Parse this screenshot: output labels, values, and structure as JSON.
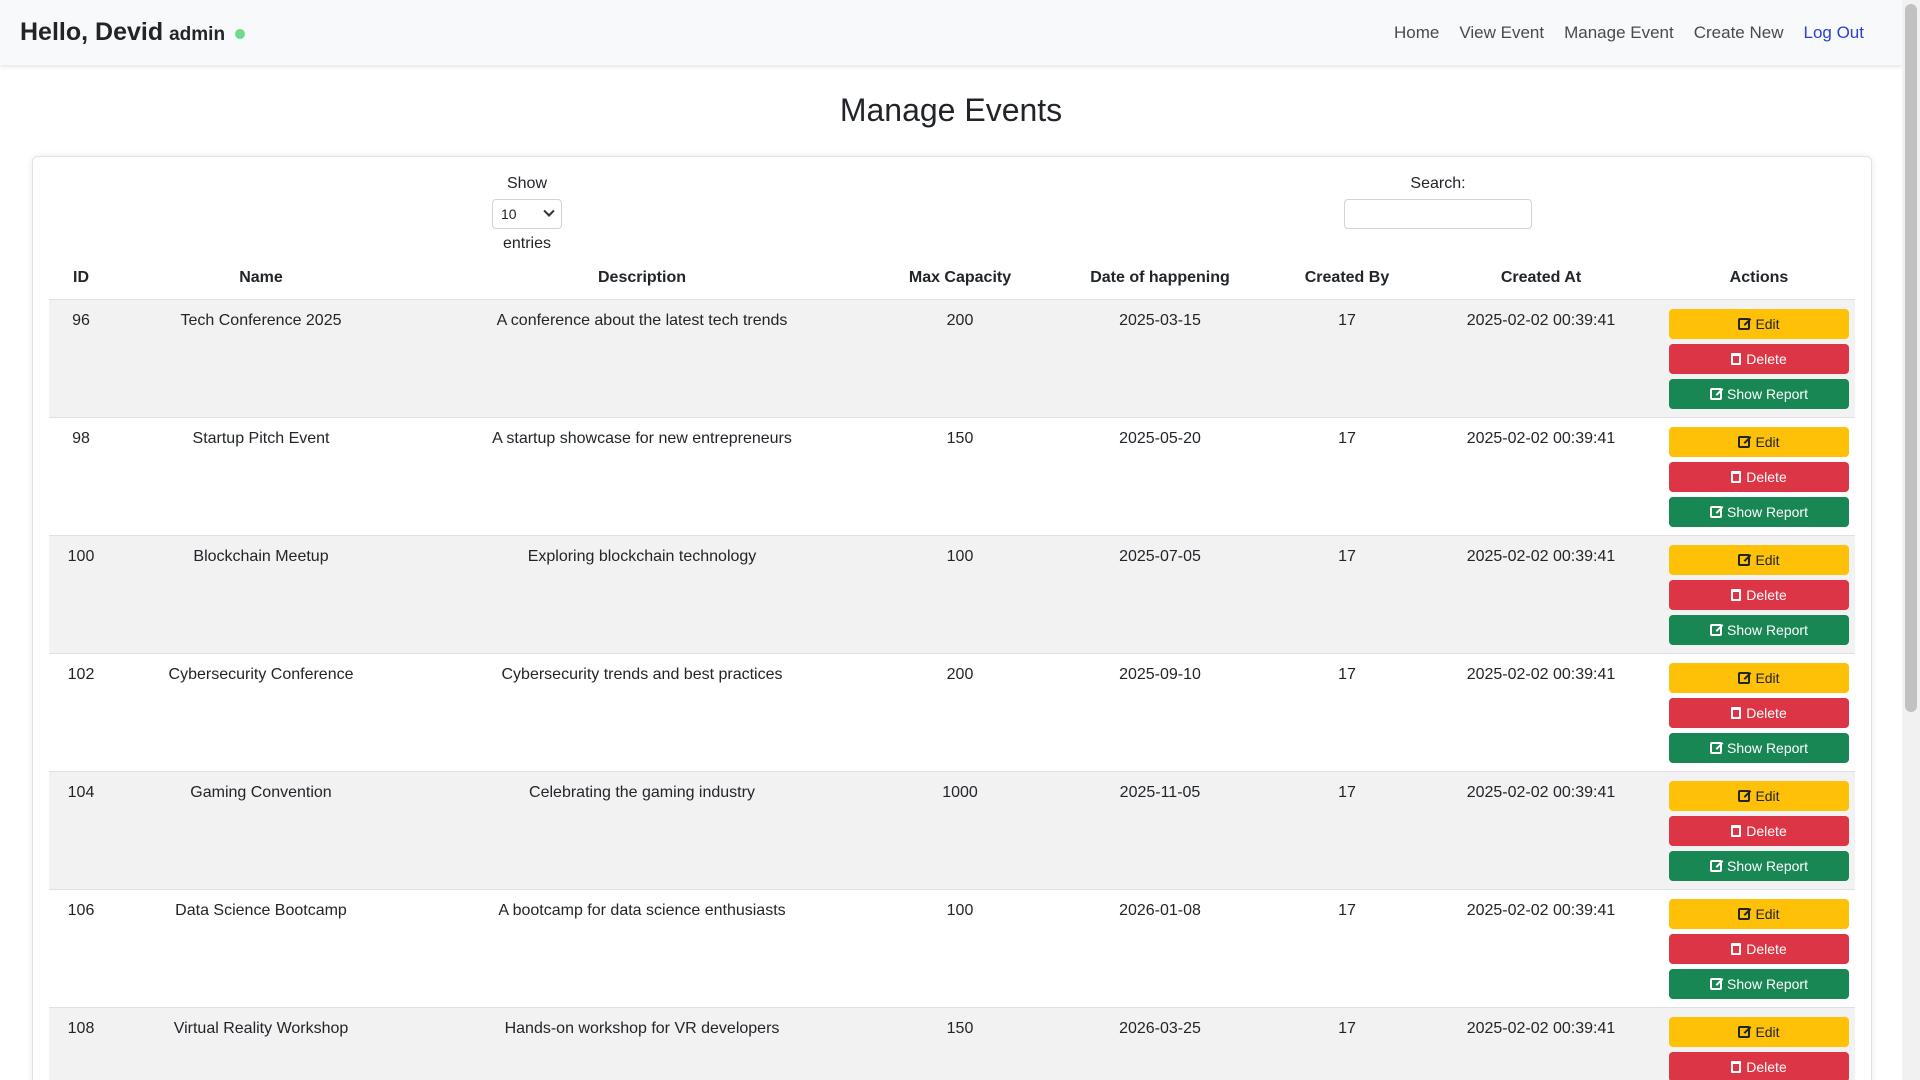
{
  "nav": {
    "greeting": "Hello, Devid",
    "role": "admin",
    "links": [
      "Home",
      "View Event",
      "Manage Event",
      "Create New",
      "Log Out"
    ]
  },
  "page": {
    "title": "Manage Events"
  },
  "length_control": {
    "show_label": "Show",
    "value": "10",
    "entries_label": "entries"
  },
  "search": {
    "label": "Search:",
    "value": ""
  },
  "table": {
    "headers": [
      "ID",
      "Name",
      "Description",
      "Max Capacity",
      "Date of happening",
      "Created By",
      "Created At",
      "Actions"
    ],
    "rows": [
      [
        "96",
        "Tech Conference 2025",
        "A conference about the latest tech trends",
        "200",
        "2025-03-15",
        "17",
        "2025-02-02 00:39:41"
      ],
      [
        "98",
        "Startup Pitch Event",
        "A startup showcase for new entrepreneurs",
        "150",
        "2025-05-20",
        "17",
        "2025-02-02 00:39:41"
      ],
      [
        "100",
        "Blockchain Meetup",
        "Exploring blockchain technology",
        "100",
        "2025-07-05",
        "17",
        "2025-02-02 00:39:41"
      ],
      [
        "102",
        "Cybersecurity Conference",
        "Cybersecurity trends and best practices",
        "200",
        "2025-09-10",
        "17",
        "2025-02-02 00:39:41"
      ],
      [
        "104",
        "Gaming Convention",
        "Celebrating the gaming industry",
        "1000",
        "2025-11-05",
        "17",
        "2025-02-02 00:39:41"
      ],
      [
        "106",
        "Data Science Bootcamp",
        "A bootcamp for data science enthusiasts",
        "100",
        "2026-01-08",
        "17",
        "2025-02-02 00:39:41"
      ],
      [
        "108",
        "Virtual Reality Workshop",
        "Hands-on workshop for VR developers",
        "150",
        "2026-03-25",
        "17",
        "2025-02-02 00:39:41"
      ]
    ],
    "actions": {
      "edit": "Edit",
      "delete": "Delete",
      "report": "Show Report"
    }
  },
  "colors": {
    "edit": "#ffc107",
    "delete": "#dc3545",
    "report": "#198754",
    "logout_link": "#2b3fd0",
    "status_dot": "#6fdc8c"
  }
}
